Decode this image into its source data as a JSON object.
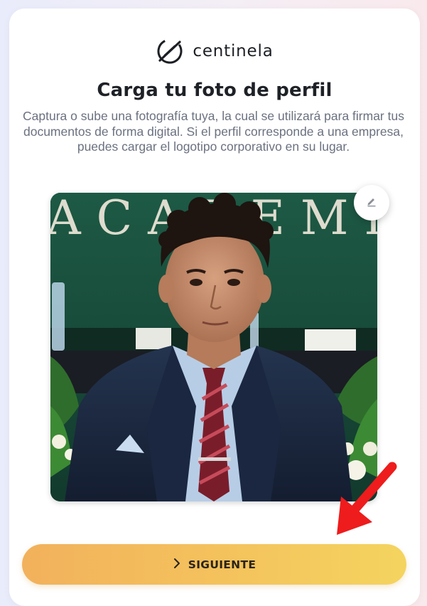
{
  "brand": {
    "name": "centinela",
    "logo_icon": "centinela-logo-icon"
  },
  "page": {
    "title": "Carga tu foto de perfil",
    "description": "Captura o sube una fotografía tuya, la cual se utilizará para firmar tus documentos de forma digital. Si el perfil corresponde a una empresa, puedes cargar el logotipo corporativo en su lugar."
  },
  "photo": {
    "background_sign": "ACADEMI",
    "edit_icon": "pencil-icon"
  },
  "actions": {
    "next_label": "SIGUIENTE",
    "next_icon": "chevron-right-icon"
  },
  "colors": {
    "button_start": "#f2b15c",
    "button_end": "#f4d45f",
    "annotation_arrow": "#ee1c1c"
  }
}
